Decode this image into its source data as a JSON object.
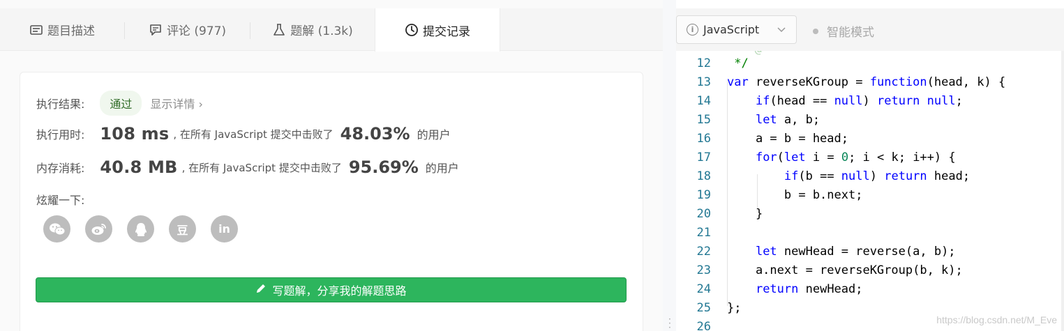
{
  "tabs": [
    {
      "label": "题目描述",
      "icon": "description-icon"
    },
    {
      "label": "评论 (977)",
      "icon": "comment-icon"
    },
    {
      "label": "题解 (1.3k)",
      "icon": "flask-icon"
    },
    {
      "label": "提交记录",
      "icon": "clock-icon"
    }
  ],
  "result": {
    "label": "执行结果:",
    "status": "通过",
    "detail": "显示详情 ›"
  },
  "runtime": {
    "label": "执行用时:",
    "value": "108 ms",
    "text": ", 在所有 JavaScript 提交中击败了",
    "percent": "48.03%",
    "suffix": "的用户"
  },
  "memory": {
    "label": "内存消耗:",
    "value": "40.8 MB",
    "text": ", 在所有 JavaScript 提交中击败了",
    "percent": "95.69%",
    "suffix": "的用户"
  },
  "share": {
    "label": "炫耀一下:",
    "buttons": [
      "wechat-icon",
      "weibo-icon",
      "qq-icon",
      "douban-icon",
      "linkedin-icon"
    ],
    "douban_glyph": "豆",
    "linkedin_glyph": "in"
  },
  "write_button": "写题解，分享我的解题思路",
  "language": "JavaScript",
  "smart_mode": "智能模式",
  "code_lines": [
    {
      "n": "12",
      "text": " */"
    },
    {
      "n": "13",
      "text": "var reverseKGroup = function(head, k) {"
    },
    {
      "n": "14",
      "text": "    if(head == null) return null;"
    },
    {
      "n": "15",
      "text": "    let a, b;"
    },
    {
      "n": "16",
      "text": "    a = b = head;"
    },
    {
      "n": "17",
      "text": "    for(let i = 0; i < k; i++) {"
    },
    {
      "n": "18",
      "text": "        if(b == null) return head;"
    },
    {
      "n": "19",
      "text": "        b = b.next;"
    },
    {
      "n": "20",
      "text": "    }"
    },
    {
      "n": "21",
      "text": ""
    },
    {
      "n": "22",
      "text": "    let newHead = reverse(a, b);"
    },
    {
      "n": "23",
      "text": "    a.next = reverseKGroup(b, k);"
    },
    {
      "n": "24",
      "text": "    return newHead;"
    },
    {
      "n": "25",
      "text": "};"
    },
    {
      "n": "26",
      "text": ""
    }
  ],
  "watermark": "https://blog.csdn.net/M_Eve",
  "colors": {
    "accent_green": "#2db55d",
    "keyword": "#0000ff",
    "number": "#098658",
    "comment": "#008000",
    "line_number": "#237893"
  }
}
